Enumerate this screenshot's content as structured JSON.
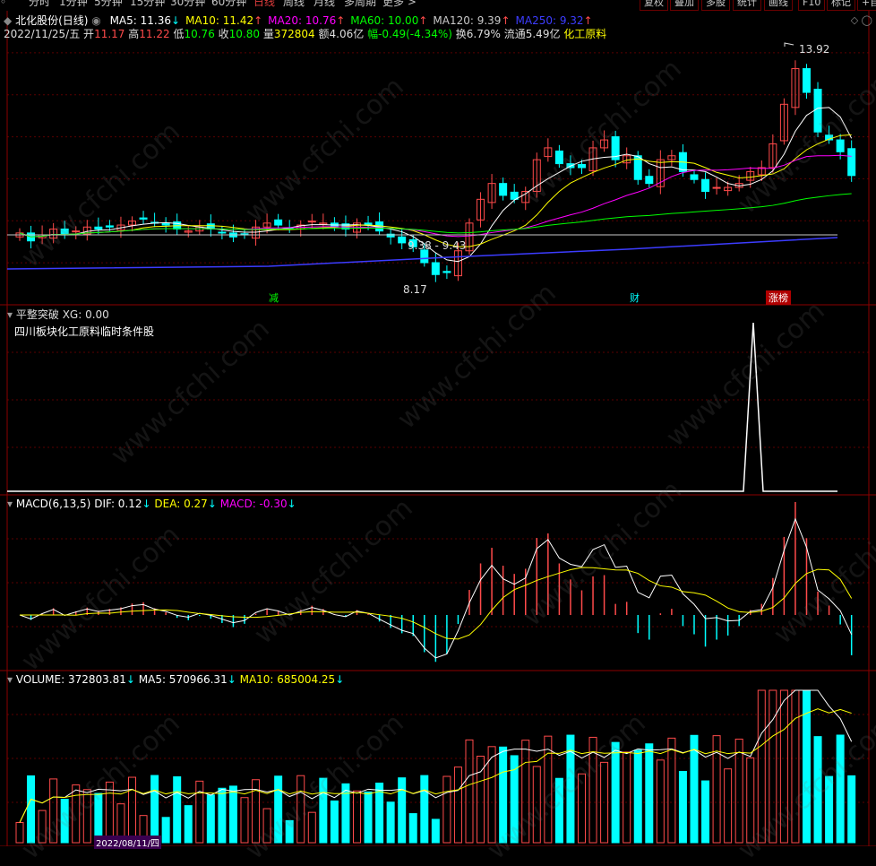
{
  "toolbar": {
    "periods": [
      "分时",
      "1分钟",
      "5分钟",
      "15分钟",
      "30分钟",
      "60分钟",
      "日线",
      "周线",
      "月线",
      "多周期",
      "更多 >"
    ],
    "selected": "日线",
    "right_buttons": [
      "复权",
      "叠加",
      "多股",
      "统计",
      "画线",
      "F10",
      "标记",
      "+自"
    ]
  },
  "main_panel": {
    "stock_name": "北化股份(日线)",
    "ma_values": [
      {
        "label": "MA5: 11.36",
        "arrow": "↓",
        "color": "#ffffff"
      },
      {
        "label": "MA10: 11.42",
        "arrow": "↑",
        "color": "#ffff00"
      },
      {
        "label": "MA20: 10.76",
        "arrow": "↑",
        "color": "#ff00ff"
      },
      {
        "label": "MA60: 10.00",
        "arrow": "↑",
        "color": "#00ff00"
      },
      {
        "label": "MA120: 9.39",
        "arrow": "↑",
        "color": "#c8c8c8"
      },
      {
        "label": "MA250: 9.32",
        "arrow": "↑",
        "color": "#3c3cff"
      }
    ],
    "info": {
      "date": "2022/11/25/五",
      "open_label": "开",
      "open": "11.17",
      "high_label": "高",
      "high": "11.22",
      "low_label": "低",
      "low": "10.76",
      "close_label": "收",
      "close": "10.80",
      "vol_label": "量",
      "vol": "372804",
      "amount": "额4.06亿",
      "change": "幅-0.49(-4.34%)",
      "turnover": "换6.79%",
      "float": "流通5.49亿",
      "sector": "化工原料"
    },
    "annotations": {
      "high_price": "13.92",
      "low_price": "8.17",
      "range": "9.38 - 9.43",
      "tag_reduce": "减",
      "tag_fin": "财",
      "tag_limit": "涨榜"
    }
  },
  "indicator_panel": {
    "title": "平整突破",
    "value": "XG: 0.00",
    "desc": "四川板块化工原料临时条件股"
  },
  "macd_panel": {
    "title": "MACD(6,13,5)",
    "dif": "DIF: 0.12",
    "dif_arrow": "↓",
    "dea": "DEA: 0.27",
    "dea_arrow": "↓",
    "macd": "MACD: -0.30",
    "macd_arrow": "↓"
  },
  "volume_panel": {
    "title": "VOLUME: 372803.81",
    "title_arrow": "↓",
    "ma5": "MA5: 570966.31",
    "ma5_arrow": "↓",
    "ma10": "MA10: 685004.25",
    "ma10_arrow": "↓"
  },
  "bottom_dates": [
    "2022/08/11/四"
  ],
  "watermark": "www.cfchi.com",
  "colors": {
    "up": "#ff4a4a",
    "down": "#00ffff",
    "grid": "#5a0000",
    "border": "#8b0000"
  }
}
